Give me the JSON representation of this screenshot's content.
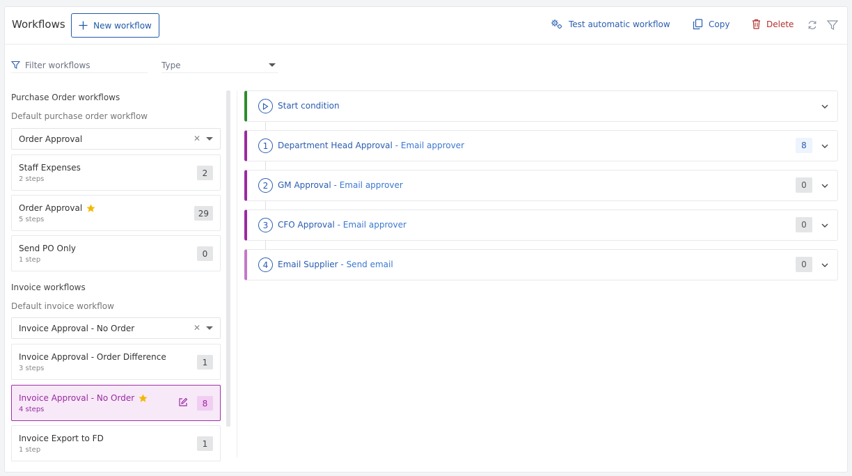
{
  "header": {
    "title": "Workflows",
    "new_label": "New workflow",
    "test_label": "Test automatic workflow",
    "copy_label": "Copy",
    "delete_label": "Delete"
  },
  "filters": {
    "search_placeholder": "Filter workflows",
    "type_label": "Type"
  },
  "purchase": {
    "title": "Purchase Order workflows",
    "default_label": "Default purchase order workflow",
    "default_value": "Order Approval",
    "items": [
      {
        "name": "Staff Expenses",
        "steps": "2 steps",
        "count": "2"
      },
      {
        "name": "Order Approval",
        "steps": "5 steps",
        "count": "29",
        "starred": true
      },
      {
        "name": "Send PO Only",
        "steps": "1 step",
        "count": "0"
      }
    ]
  },
  "invoice": {
    "title": "Invoice workflows",
    "default_label": "Default invoice workflow",
    "default_value": "Invoice Approval - No Order",
    "items": [
      {
        "name": "Invoice Approval - Order Difference",
        "steps": "3 steps",
        "count": "1"
      },
      {
        "name": "Invoice Approval - No Order",
        "steps": "4 steps",
        "count": "8",
        "starred": true,
        "active": true
      },
      {
        "name": "Invoice Export to FD",
        "steps": "1 step",
        "count": "1"
      }
    ]
  },
  "steps": {
    "start_label": "Start condition",
    "items": [
      {
        "num": "1",
        "name": "Department Head Approval",
        "sep": "-",
        "action": "Email approver",
        "count": "8"
      },
      {
        "num": "2",
        "name": "GM Approval",
        "sep": "-",
        "action": "Email approver",
        "count": "0"
      },
      {
        "num": "3",
        "name": "CFO Approval",
        "sep": "-",
        "action": "Email approver",
        "count": "0"
      },
      {
        "num": "4",
        "name": "Email Supplier",
        "sep": "-",
        "action": "Send email",
        "count": "0"
      }
    ]
  },
  "colors": {
    "brand_blue": "#1e5aa8",
    "active_purple": "#9a2aa2",
    "start_green": "#2e8b2e",
    "delete_red": "#b0302d",
    "star_yellow": "#f5b800"
  }
}
